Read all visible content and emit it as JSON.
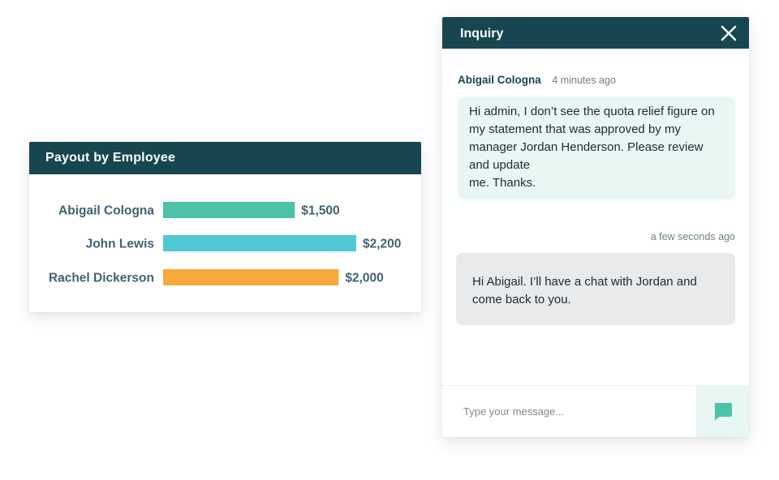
{
  "payout": {
    "title": "Payout by Employee"
  },
  "chart_data": {
    "type": "bar",
    "orientation": "horizontal",
    "categories": [
      "Abigail Cologna",
      "John Lewis",
      "Rachel Dickerson"
    ],
    "values": [
      1500,
      2200,
      2000
    ],
    "value_labels": [
      "$1,500",
      "$2,200",
      "$2,000"
    ],
    "colors": [
      "#4cc2a8",
      "#4fc8d3",
      "#f7a93a"
    ],
    "title": "Payout by Employee",
    "xlabel": "",
    "ylabel": "",
    "xlim": [
      0,
      2200
    ],
    "grid": false,
    "legend": "none"
  },
  "chat": {
    "title": "Inquiry",
    "close_icon": "close-icon",
    "messages": [
      {
        "author": "Abigail Cologna",
        "time": "4 minutes ago",
        "text": "Hi admin, I don’t see the quota relief figure on my statement that was approved by my manager Jordan Henderson. Please review and update\nme. Thanks."
      },
      {
        "author": "",
        "time": "a few seconds ago",
        "text": "Hi Abigail. I’ll have a chat with Jordan and come back to you."
      }
    ],
    "composer": {
      "placeholder": "Type your message...",
      "send_icon": "chat-bubble-icon",
      "send_color": "#4cc2a8"
    }
  },
  "colors": {
    "header_bg": "#174651",
    "incoming_bubble": "#e9f7f4",
    "outgoing_bubble": "#e8eaeb"
  }
}
